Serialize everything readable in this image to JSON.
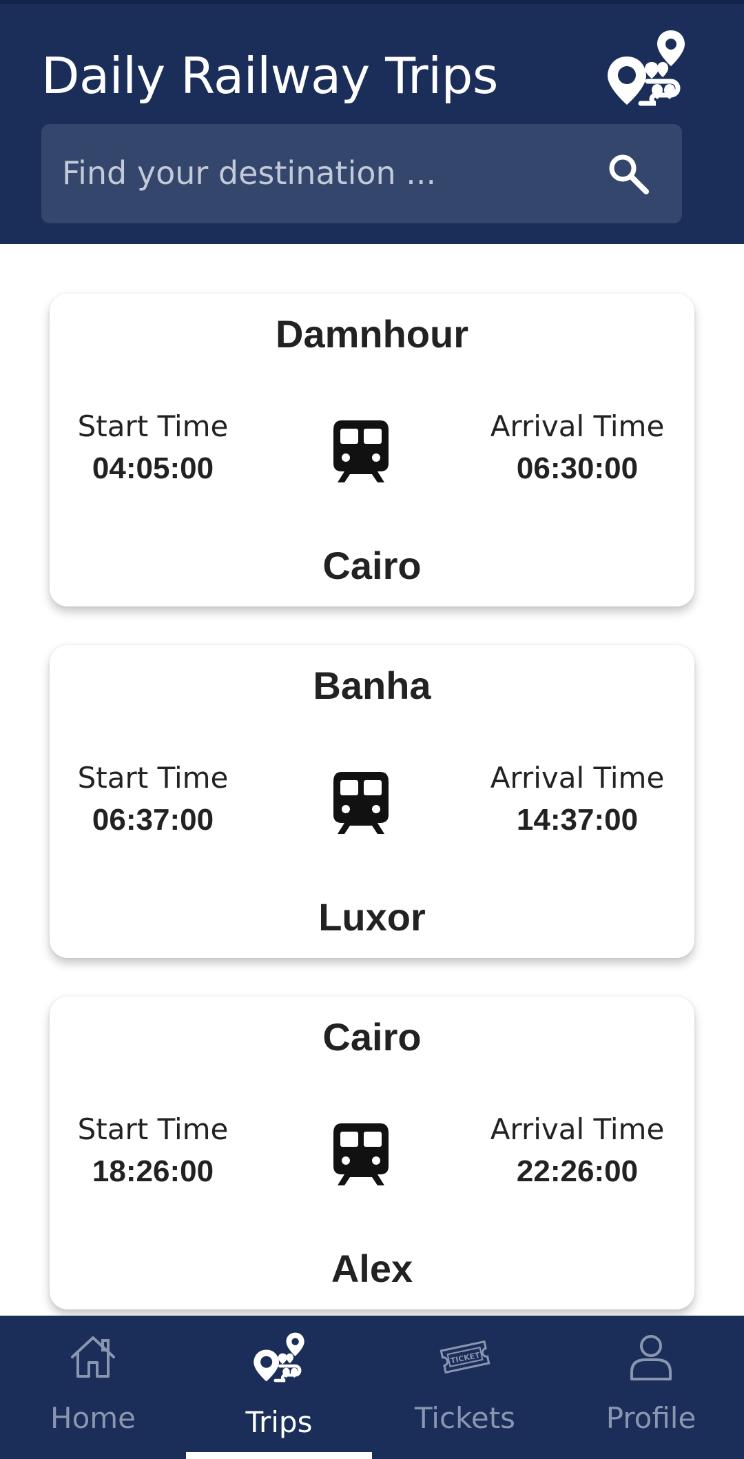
{
  "header": {
    "title": "Daily Railway Trips",
    "logo_icon": "route-map-pin-icon"
  },
  "search": {
    "placeholder": "Find your destination ...",
    "icon": "search-icon"
  },
  "trips": [
    {
      "from": "Damnhour",
      "to": "Cairo",
      "start_label": "Start Time",
      "start_time": "04:05:00",
      "arrival_label": "Arrival Time",
      "arrival_time": "06:30:00",
      "icon": "train-icon"
    },
    {
      "from": "Banha",
      "to": "Luxor",
      "start_label": "Start Time",
      "start_time": "06:37:00",
      "arrival_label": "Arrival Time",
      "arrival_time": "14:37:00",
      "icon": "train-icon"
    },
    {
      "from": "Cairo",
      "to": "Alex",
      "start_label": "Start Time",
      "start_time": "18:26:00",
      "arrival_label": "Arrival Time",
      "arrival_time": "22:26:00",
      "icon": "train-icon"
    }
  ],
  "nav": {
    "items": [
      {
        "label": "Home",
        "icon": "home-icon",
        "active": false
      },
      {
        "label": "Trips",
        "icon": "route-map-pin-icon",
        "active": true
      },
      {
        "label": "Tickets",
        "icon": "ticket-icon",
        "active": false
      },
      {
        "label": "Profile",
        "icon": "user-icon",
        "active": false
      }
    ]
  },
  "colors": {
    "primary": "#1a2e59",
    "search_bg": "#34466c",
    "inactive_nav": "#8a96b0",
    "active_nav": "#ffffff"
  }
}
